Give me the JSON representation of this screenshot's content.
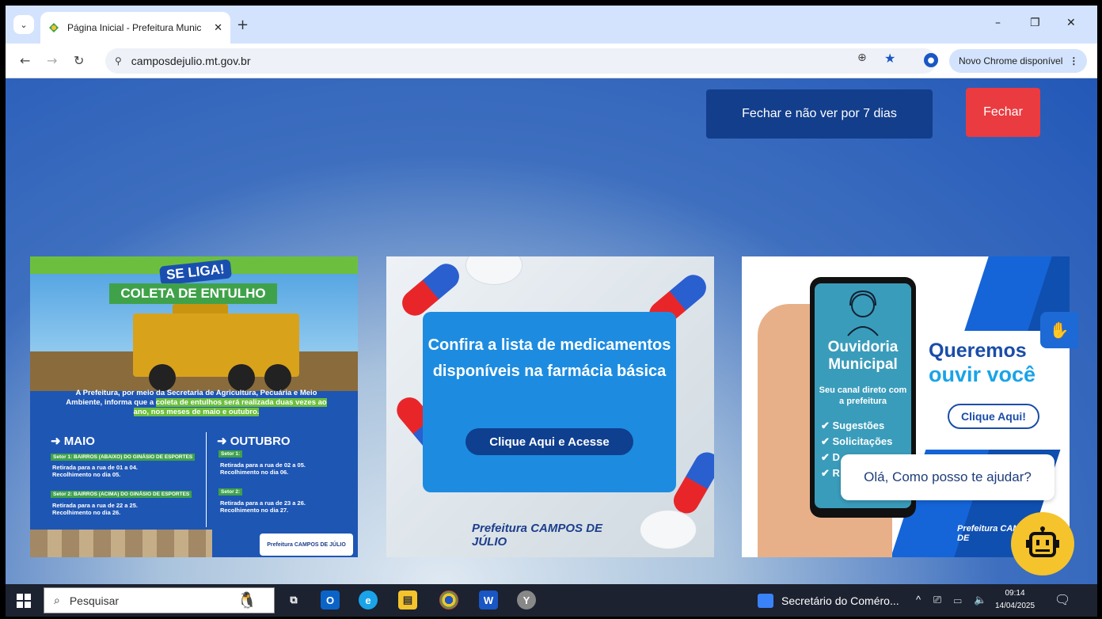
{
  "browser": {
    "tab_title": "Página Inicial - Prefeitura Munic",
    "tab_close": "✕",
    "new_tab": "+",
    "url": "camposdejulio.mt.gov.br",
    "update_label": "Novo Chrome disponível",
    "window_min": "–",
    "window_restore": "❐",
    "window_close": "✕"
  },
  "popup": {
    "hide_7_days": "Fechar e não ver por 7 dias",
    "close": "Fechar"
  },
  "cards": {
    "entulho": {
      "badge": "SE LIGA!",
      "title": "COLETA DE ENTULHO",
      "intro_a": "A Prefeitura, por meio da Secretaria de Agricultura, Pecuária e Meio Ambiente, informa que a ",
      "intro_hl": "coleta de entulhos será realizada duas vezes ao ano, nos meses de maio e outubro.",
      "col1_title": "➜ MAIO",
      "col2_title": "➜ OUTUBRO",
      "m_setor1": "Setor 1: BAIRROS (ABAIXO) DO GINÁSIO DE ESPORTES",
      "m_setor1_txt1": "Retirada para a rua de 01 a 04.",
      "m_setor1_txt2": "Recolhimento no dia 05.",
      "m_setor2": "Setor 2: BAIRROS (ACIMA) DO GINÁSIO DE ESPORTES",
      "m_setor2_txt1": "Retirada para a rua de 22 a 25.",
      "m_setor2_txt2": "Recolhimento no dia 26.",
      "o_setor1": "Setor 1:",
      "o_setor1_txt1": "Retirada para a rua de 02 a 05.",
      "o_setor1_txt2": "Recolhimento no dia 06.",
      "o_setor2": "Setor 2:",
      "o_setor2_txt1": "Retirada para a rua de 23 a 26.",
      "o_setor2_txt2": "Recolhimento no dia 27.",
      "logo": "Prefeitura CAMPOS DE JÚLIO"
    },
    "farmacia": {
      "headline": "Confira a lista de medicamentos disponíveis na farmácia básica",
      "cta": "Clique Aqui e Acesse",
      "logo": "Prefeitura CAMPOS DE JÚLIO"
    },
    "ouvidoria": {
      "title": "Ouvidoria Municipal",
      "subtitle": "Seu canal direto com a prefeitura",
      "item1": "Sugestões",
      "item2": "Solicitações",
      "item3": "D",
      "item4": "R",
      "queremos": "Queremos",
      "ouvir": "ouvir você",
      "cta": "Clique Aqui!",
      "logo": "Prefeitura CAMPOS DE"
    }
  },
  "chat": {
    "prompt": "Olá, Como posso te ajudar?"
  },
  "taskbar": {
    "search_placeholder": "Pesquisar",
    "running_app": "Secretário do Coméro...",
    "time": "09:14",
    "date": "14/04/2025"
  },
  "colors": {
    "accent": "#1a56c4",
    "close_red": "#ea3b40",
    "popup_dark_blue": "#123e8c",
    "chatbot_yellow": "#f5c32c"
  }
}
